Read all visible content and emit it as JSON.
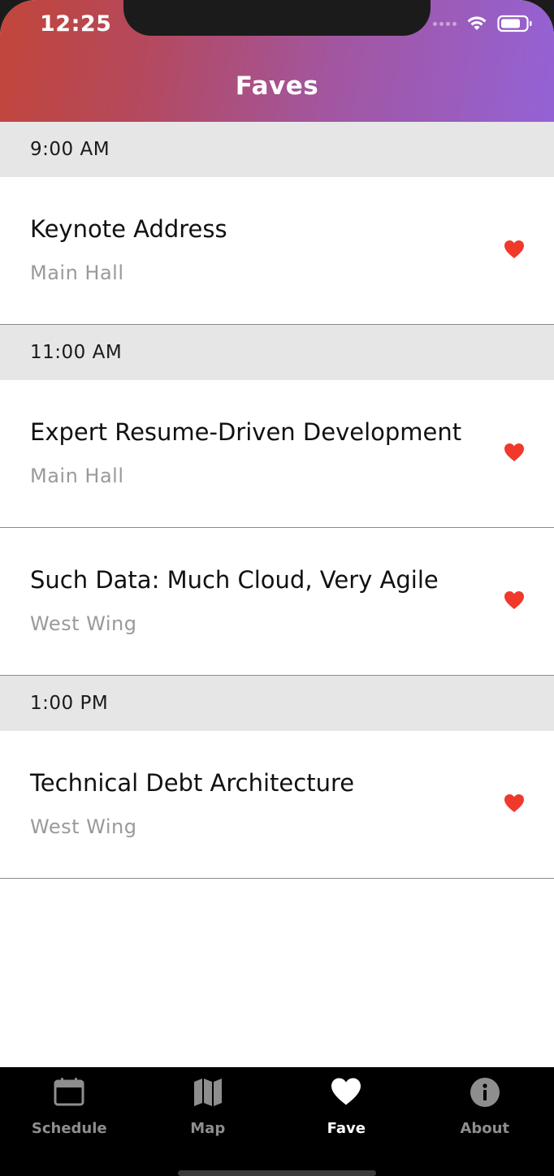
{
  "status_bar": {
    "time": "12:25"
  },
  "header": {
    "title": "Faves"
  },
  "sections": [
    {
      "time": "9:00 AM",
      "sessions": [
        {
          "title": "Keynote Address",
          "location": "Main Hall"
        }
      ]
    },
    {
      "time": "11:00 AM",
      "sessions": [
        {
          "title": "Expert Resume-Driven Development",
          "location": "Main Hall"
        },
        {
          "title": "Such Data: Much Cloud, Very Agile",
          "location": "West Wing"
        }
      ]
    },
    {
      "time": "1:00 PM",
      "sessions": [
        {
          "title": "Technical Debt Architecture",
          "location": "West Wing"
        }
      ]
    }
  ],
  "tabbar": {
    "tabs": [
      {
        "label": "Schedule",
        "icon": "calendar-icon"
      },
      {
        "label": "Map",
        "icon": "map-icon"
      },
      {
        "label": "Fave",
        "icon": "heart-icon"
      },
      {
        "label": "About",
        "icon": "info-icon"
      }
    ],
    "active": "Fave"
  },
  "colors": {
    "heart": "#f0392b",
    "header_gradient_start": "#c2463a",
    "header_gradient_end": "#9462d6"
  }
}
